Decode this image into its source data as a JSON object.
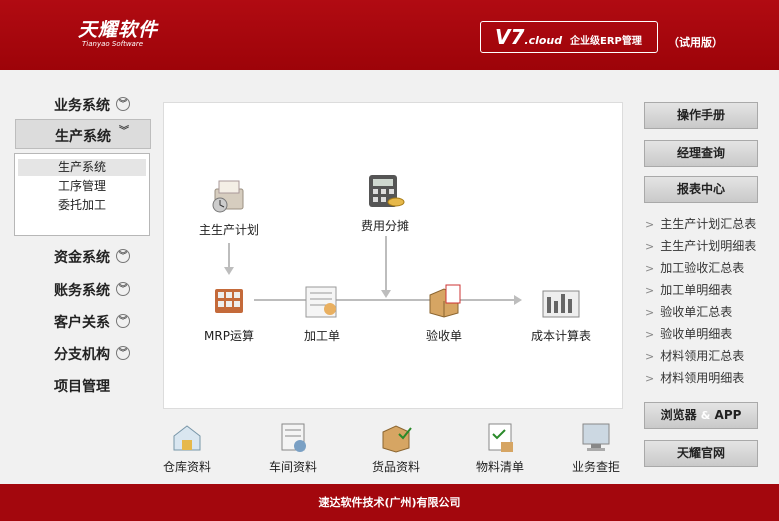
{
  "header": {
    "logo_cn": "天耀软件",
    "logo_en": "Tianyao Software",
    "version": "V7",
    "version_suffix": ".cloud",
    "erp_label": "企业级ERP管理",
    "trial_label": "（试用版）"
  },
  "nav": {
    "items": [
      {
        "label": "业务系统",
        "chevron": "︾"
      },
      {
        "label": "生产系统",
        "chevron": "︾"
      },
      {
        "label": "资金系统",
        "chevron": "︾"
      },
      {
        "label": "账务系统",
        "chevron": "︾"
      },
      {
        "label": "客户关系",
        "chevron": "︾"
      },
      {
        "label": "分支机构",
        "chevron": "︾"
      },
      {
        "label": "项目管理"
      }
    ],
    "submenu": [
      "生产系统",
      "工序管理",
      "委托加工"
    ]
  },
  "flow": {
    "master_plan": "主生产计划",
    "cost_alloc": "费用分摊",
    "mrp": "MRP运算",
    "process_order": "加工单",
    "acceptance": "验收单",
    "cost_sheet": "成本计算表"
  },
  "quick": [
    "仓库资料",
    "车间资料",
    "货品资料",
    "物料清单",
    "业务查拒"
  ],
  "right": {
    "manual": "操作手册",
    "manager": "经理查询",
    "report_center": "报表中心",
    "reports": [
      "主生产计划汇总表",
      "主生产计划明细表",
      "加工验收汇总表",
      "加工单明细表",
      "验收单汇总表",
      "验收单明细表",
      "材料领用汇总表",
      "材料领用明细表"
    ],
    "browser_left": "浏览器",
    "browser_amp": "&",
    "browser_right": "APP",
    "official": "天耀官网"
  },
  "footer": {
    "company": "速达软件技术(广州)有限公司"
  },
  "colors": {
    "brand_red": "#a3070d",
    "panel_bg": "#f1f1f1"
  }
}
